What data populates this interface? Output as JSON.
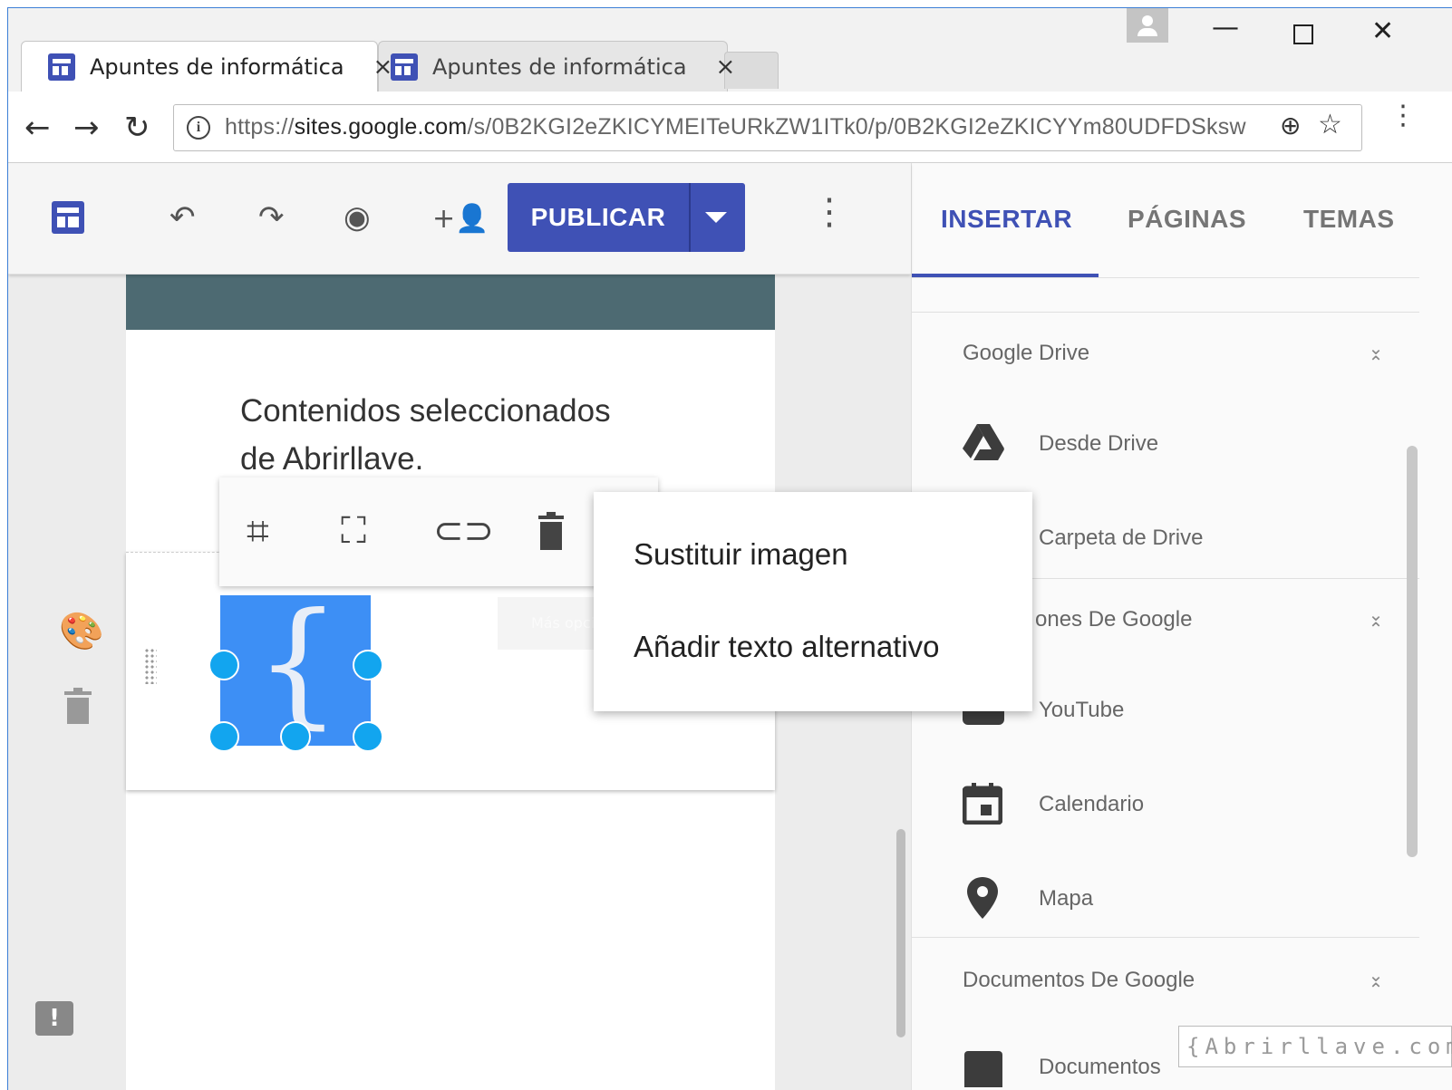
{
  "browser": {
    "tabs": [
      {
        "title": "Apuntes de informática",
        "close": "×"
      },
      {
        "title": "Apuntes de informática",
        "close": "×"
      }
    ],
    "url_scheme": "https://",
    "url_host": "sites.google.com",
    "url_path": "/s/0B2KGI2eZKICYMEITeURkZW1ITk0/p/0B2KGI2eZKICYYm80UDFDSksw"
  },
  "toolbar": {
    "publish_label": "PUBLICAR",
    "colors": {
      "primary": "#3f51b5",
      "header_band": "#4d6a72",
      "handle": "#12a5ef"
    }
  },
  "page": {
    "text": "Contenidos seleccionados de Abrirllave.",
    "tooltip": "Más opciones de edición"
  },
  "context_menu": {
    "items": [
      "Sustituir imagen",
      "Añadir texto alternativo"
    ]
  },
  "panel": {
    "tabs": [
      "INSERTAR",
      "PÁGINAS",
      "TEMAS"
    ],
    "sections": [
      {
        "title": "Google Drive",
        "items": [
          "Desde Drive",
          "Carpeta de Drive"
        ]
      },
      {
        "title": "ones De Google",
        "items": [
          "YouTube",
          "Calendario",
          "Mapa"
        ]
      },
      {
        "title": "Documentos De Google",
        "items": [
          "Documentos"
        ]
      }
    ]
  },
  "watermark": "{Abrirllave.com"
}
